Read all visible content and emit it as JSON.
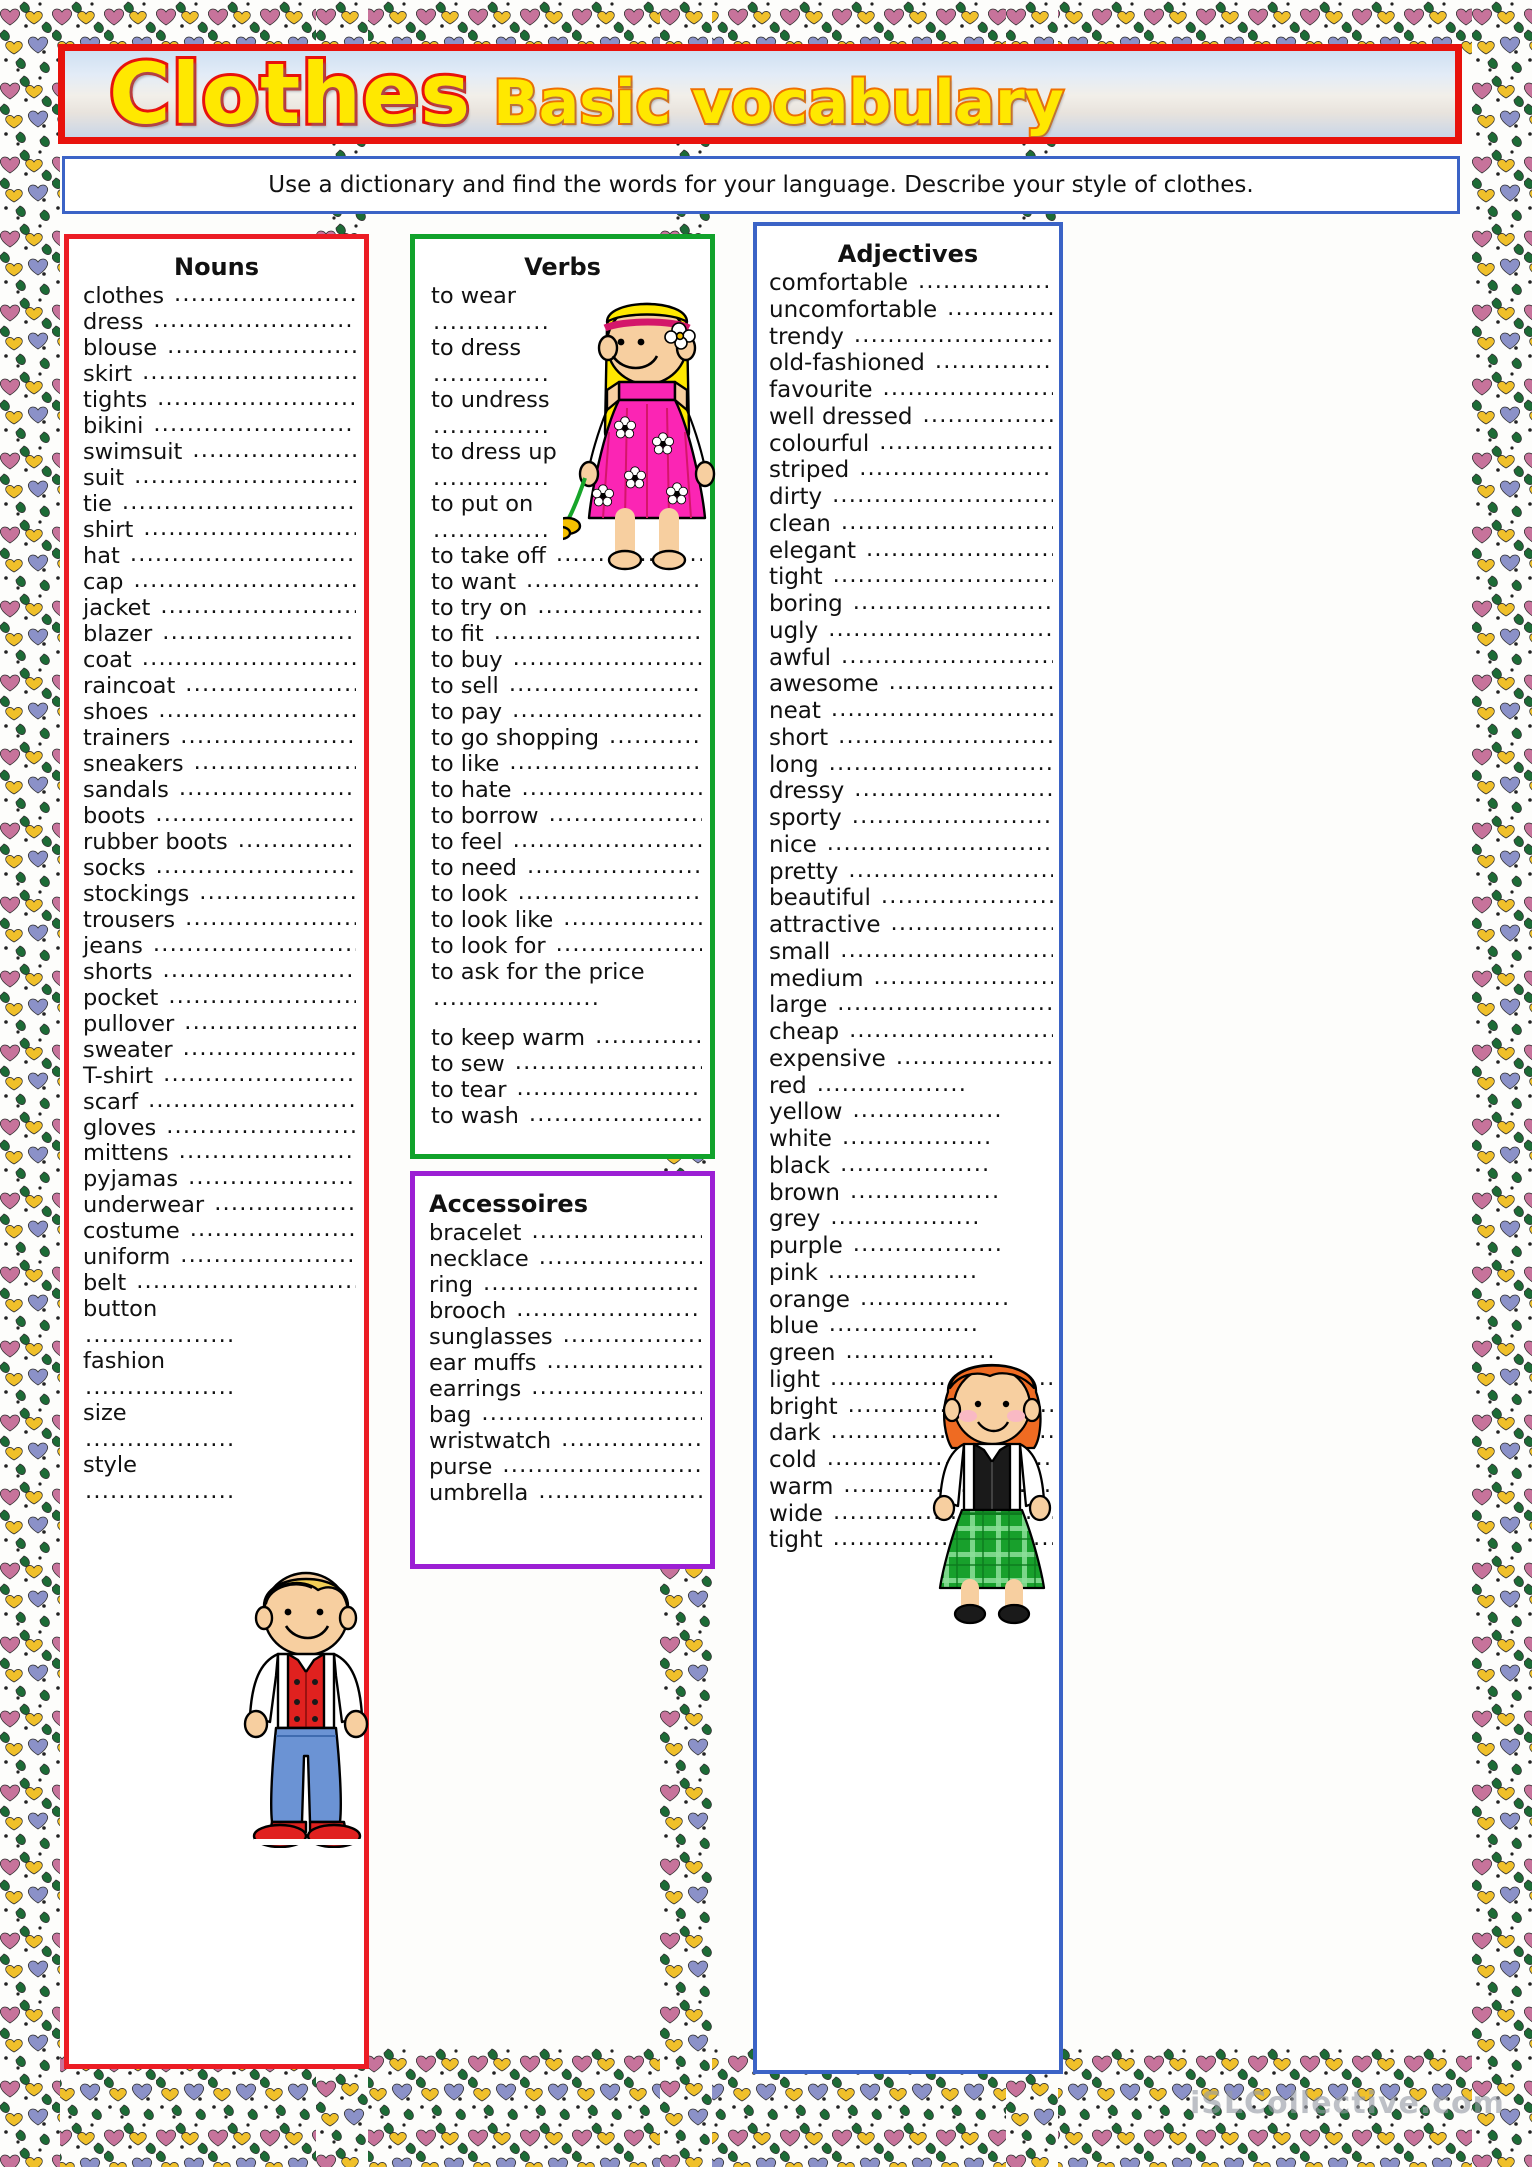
{
  "title": {
    "main": "Clothes",
    "sub": "Basic vocabulary"
  },
  "instruction": "Use a dictionary and find the words for your language.  Describe your style of clothes.",
  "watermark": "iSLCollective.com",
  "colors": {
    "title_fill": "#ffe800",
    "title_stroke": "#e8120c",
    "subtitle_stroke": "#f07000",
    "nouns_border": "#ec1c24",
    "verbs_border": "#11a22b",
    "accessoires_border": "#9c1fd4",
    "adjectives_border": "#3b63c6",
    "instruction_border": "#3b63c6"
  },
  "columns": {
    "nouns": {
      "heading": "Nouns",
      "items": [
        "clothes",
        "dress",
        "blouse",
        "skirt",
        "tights",
        "bikini",
        "swimsuit",
        "suit",
        "tie",
        "shirt",
        "hat",
        "cap",
        "jacket",
        "blazer",
        "coat",
        "raincoat",
        "shoes",
        "trainers",
        "sneakers",
        "sandals",
        "boots",
        "rubber boots",
        "socks",
        "stockings",
        "trousers",
        "jeans",
        "shorts",
        "pocket",
        "pullover",
        "sweater",
        "T-shirt",
        "scarf",
        "gloves",
        "mittens",
        "pyjamas",
        "underwear",
        "costume",
        "uniform",
        "belt"
      ],
      "wrapped_items": [
        "button",
        "fashion",
        "size",
        "style"
      ]
    },
    "verbs": {
      "heading": "Verbs",
      "wrapped_items": [
        "to wear",
        "to dress",
        "to undress",
        "to dress up",
        "to put on"
      ],
      "items": [
        "to take off",
        "to want",
        "to try on",
        "to fit",
        "to buy",
        "to sell",
        "to pay",
        "to go shopping",
        "to like",
        "to hate",
        "to borrow",
        "to feel",
        "to need",
        "to look",
        "to look like",
        "to look for"
      ],
      "trailing_wrapped": [
        "to ask for the price"
      ],
      "tail_items": [
        "to keep warm",
        "to sew",
        "to tear",
        "to wash"
      ]
    },
    "accessoires": {
      "heading": "Accessoires",
      "items": [
        "bracelet",
        "necklace",
        "ring",
        "brooch",
        "sunglasses",
        "ear muffs",
        "earrings",
        "bag",
        "wristwatch",
        "purse",
        "umbrella"
      ]
    },
    "adjectives": {
      "heading": "Adjectives",
      "items": [
        "comfortable",
        "uncomfortable",
        "trendy",
        "old-fashioned",
        "favourite",
        "well dressed",
        "colourful",
        "striped",
        "dirty",
        "clean",
        "elegant",
        "tight",
        "boring",
        "ugly",
        "awful",
        "awesome",
        "neat",
        "short",
        "long",
        "dressy",
        "sporty",
        "nice",
        "pretty",
        "beautiful",
        "attractive",
        "small",
        "medium",
        "large",
        "cheap",
        "expensive"
      ],
      "color_items": [
        "red",
        "yellow",
        "white",
        "black",
        "brown",
        "grey",
        "purple",
        "pink",
        "orange",
        "blue",
        "green"
      ],
      "tail_items": [
        "light",
        "bright",
        "dark",
        "cold",
        "warm",
        "wide",
        "tight"
      ]
    }
  },
  "clipart": {
    "girl_pink_dress": "girl-in-pink-flower-dress",
    "boy_red_vest": "boy-in-red-vest",
    "girl_green_skirt": "girl-in-green-plaid-skirt"
  }
}
